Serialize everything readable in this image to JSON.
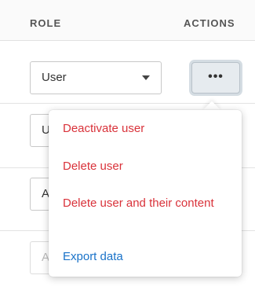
{
  "header": {
    "role_label": "ROLE",
    "actions_label": "ACTIONS"
  },
  "rows": [
    {
      "role": "User",
      "faded": false
    },
    {
      "role": "U",
      "faded": false
    },
    {
      "role": "A",
      "faded": false
    },
    {
      "role": "A",
      "faded": true
    }
  ],
  "actions": {
    "more_icon": "ellipsis-icon",
    "more_glyph": "•••"
  },
  "menu": {
    "items": [
      {
        "label": "Deactivate user",
        "kind": "danger"
      },
      {
        "label": "Delete user",
        "kind": "danger"
      },
      {
        "label": "Delete user and their content",
        "kind": "danger"
      },
      {
        "label": "Export data",
        "kind": "link"
      }
    ]
  },
  "colors": {
    "danger": "#d9323a",
    "link": "#1a73c9",
    "button_bg": "#e6ebef"
  }
}
